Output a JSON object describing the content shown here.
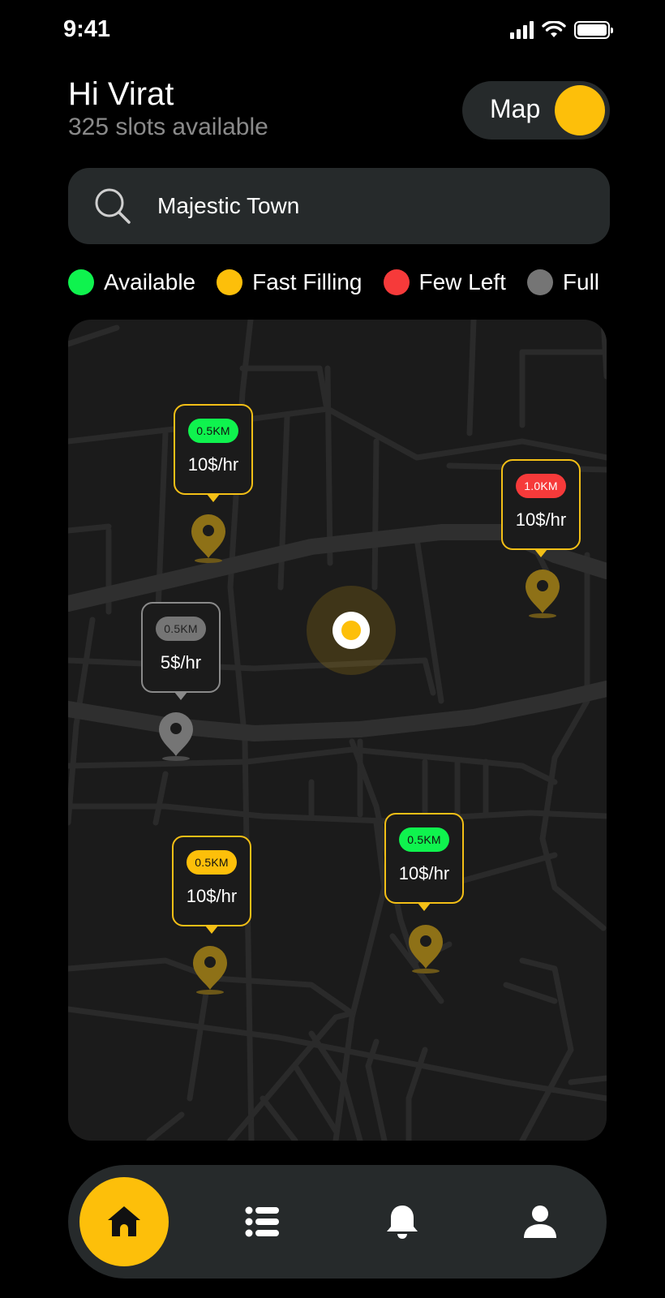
{
  "status_bar": {
    "time": "9:41"
  },
  "header": {
    "greeting": "Hi Virat",
    "slots_text": "325 slots available",
    "map_toggle_label": "Map",
    "map_toggle_on": true
  },
  "search": {
    "value": "Majestic Town",
    "icon": "search-icon"
  },
  "legend": [
    {
      "label": "Available",
      "color": "#0ff34e"
    },
    {
      "label": "Fast Filling",
      "color": "#fdbf0a"
    },
    {
      "label": "Few Left",
      "color": "#f63a3a"
    },
    {
      "label": "Full",
      "color": "#757575"
    }
  ],
  "map": {
    "spots": [
      {
        "distance": "0.5KM",
        "price": "10$/hr",
        "status": "available"
      },
      {
        "distance": "1.0KM",
        "price": "10$/hr",
        "status": "few-left"
      },
      {
        "distance": "0.5KM",
        "price": "5$/hr",
        "status": "full"
      },
      {
        "distance": "0.5KM",
        "price": "10$/hr",
        "status": "fast-filling"
      },
      {
        "distance": "0.5KM",
        "price": "10$/hr",
        "status": "available"
      }
    ]
  },
  "nav": {
    "items": [
      {
        "icon": "home-icon",
        "active": true
      },
      {
        "icon": "list-icon",
        "active": false
      },
      {
        "icon": "bell-icon",
        "active": false
      },
      {
        "icon": "user-icon",
        "active": false
      }
    ]
  },
  "colors": {
    "accent": "#fdbf0a",
    "available": "#0ff34e",
    "few_left": "#f63a3a",
    "full": "#757575"
  }
}
